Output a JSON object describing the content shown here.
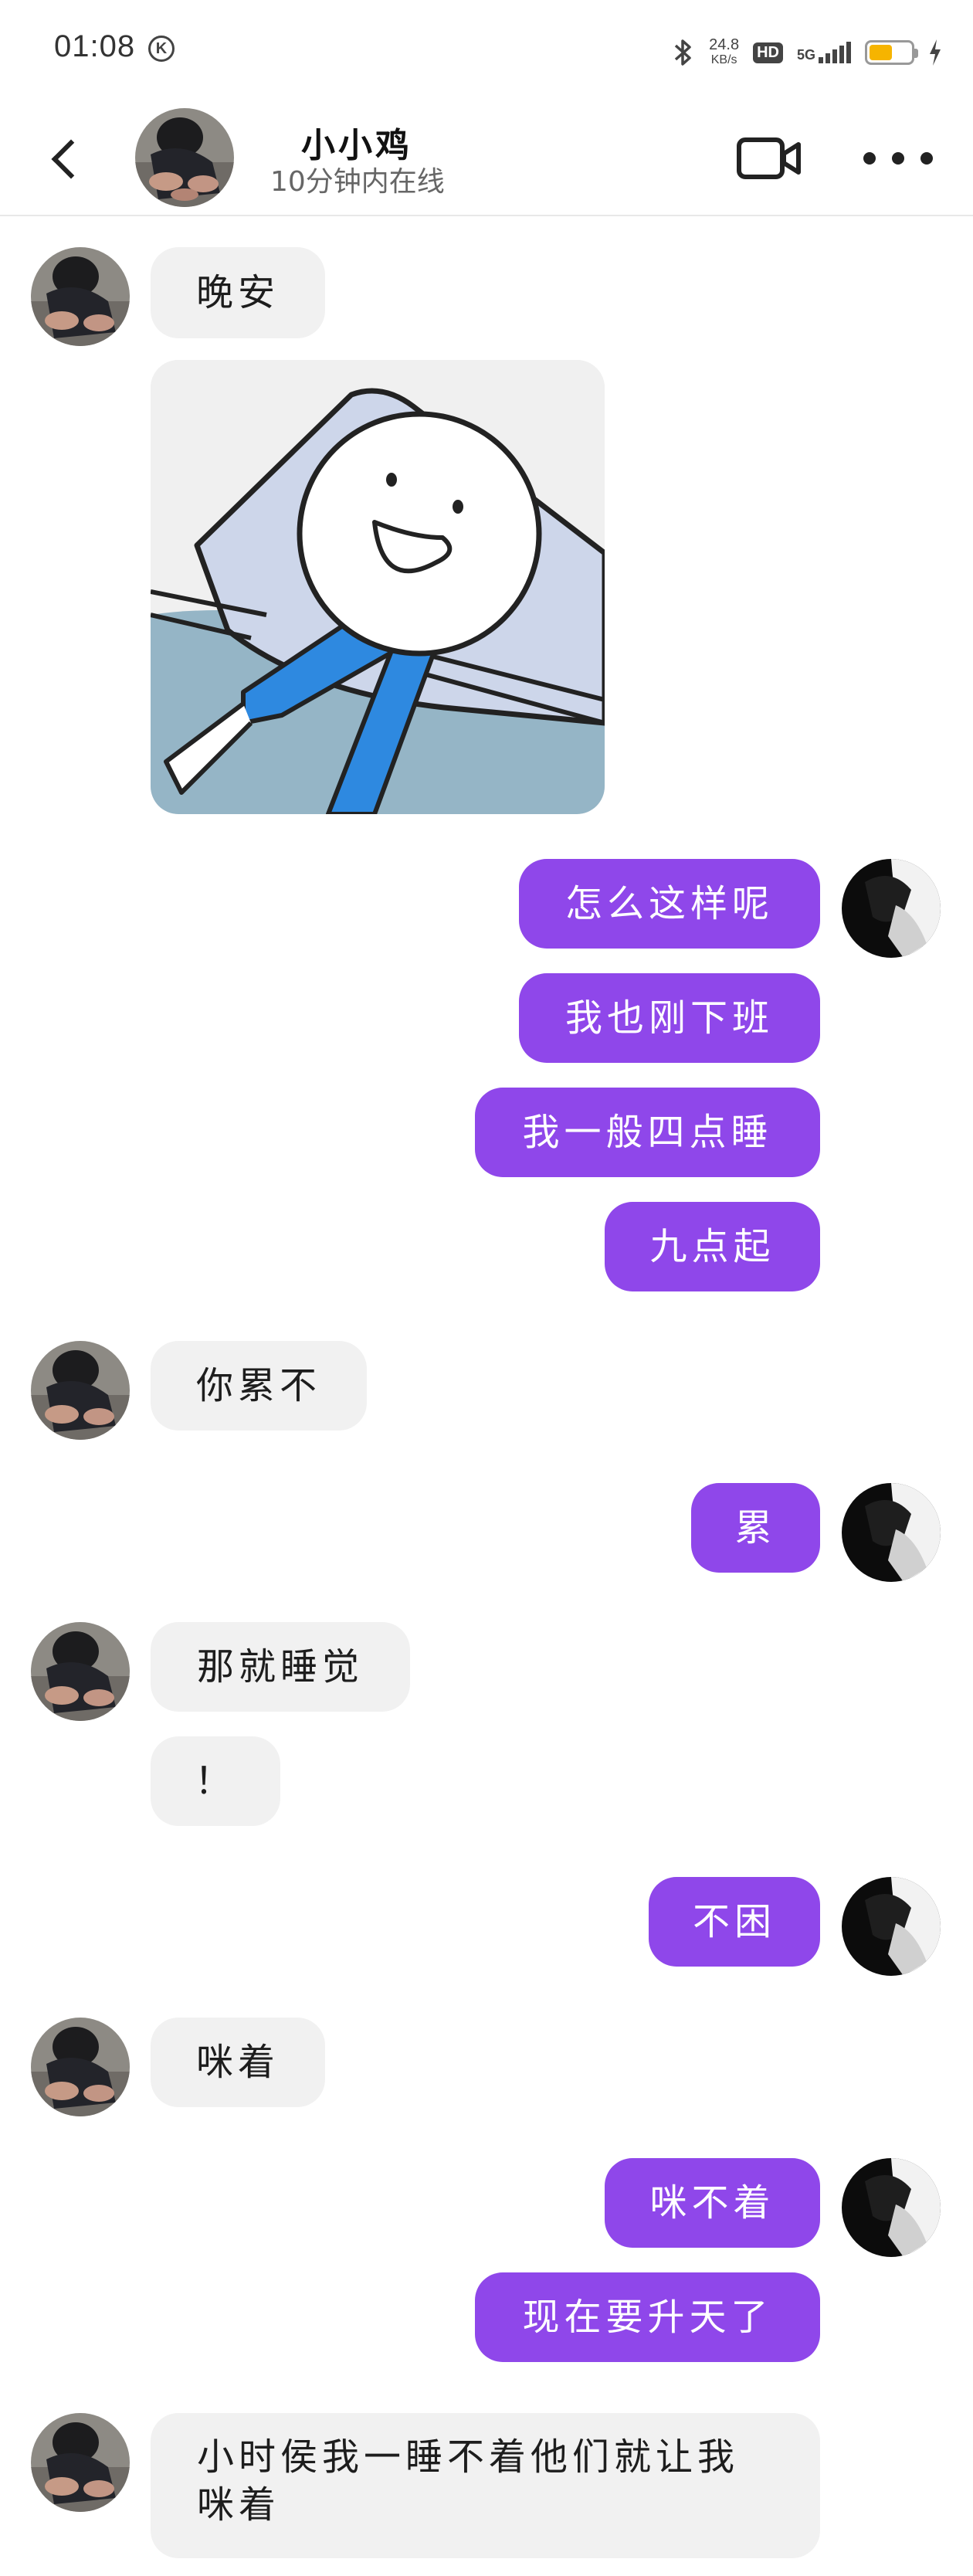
{
  "status_bar": {
    "time": "01:08",
    "k_badge": "K",
    "net_speed": "24.8",
    "net_unit": "KB/s",
    "hd": "HD",
    "network": "5G",
    "battery_level": 0.55,
    "battery_color": "#f6b400"
  },
  "header": {
    "contact_name": "小小鸡",
    "online_status": "10分钟内在线",
    "back_icon": "chevron-left-icon",
    "video_icon": "video-camera-icon",
    "more_icon": "more-dots-icon"
  },
  "colors": {
    "outgoing_bubble": "#8f47ea",
    "incoming_bubble": "#f1f1f1"
  },
  "messages": [
    {
      "from": "contact",
      "text": "晚安"
    },
    {
      "from": "contact",
      "type": "sticker",
      "sticker": "sleeping-stickman-sticker"
    },
    {
      "from": "me",
      "text": "怎么这样呢"
    },
    {
      "from": "me",
      "text": "我也刚下班"
    },
    {
      "from": "me",
      "text": "我一般四点睡"
    },
    {
      "from": "me",
      "text": "九点起"
    },
    {
      "from": "contact",
      "text": "你累不"
    },
    {
      "from": "me",
      "text": "累"
    },
    {
      "from": "contact",
      "text": "那就睡觉"
    },
    {
      "from": "contact",
      "text": "！"
    },
    {
      "from": "me",
      "text": "不困"
    },
    {
      "from": "contact",
      "text": "咪着"
    },
    {
      "from": "me",
      "text": "咪不着"
    },
    {
      "from": "me",
      "text": "现在要升天了"
    },
    {
      "from": "contact",
      "text": "小时侯我一睡不着他们就让我咪着"
    }
  ]
}
